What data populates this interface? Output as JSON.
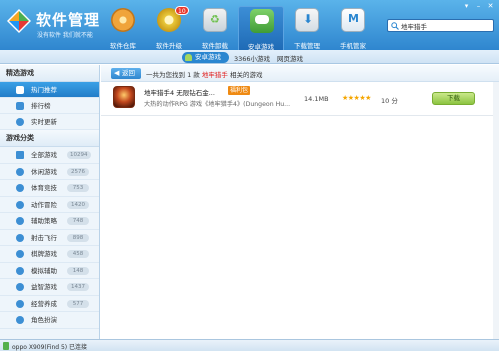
{
  "app": {
    "title": "软件管理",
    "slogan": "没有软件 我们就不能"
  },
  "nav": {
    "badge": "10",
    "items": [
      {
        "label": "软件仓库",
        "icon": "warehouse-disc-icon",
        "color": "#f0a43a"
      },
      {
        "label": "软件升级",
        "icon": "upgrade-arrow-icon",
        "color": "#e9c93b"
      },
      {
        "label": "软件卸载",
        "icon": "recycle-bin-icon",
        "color": "#6cc04a"
      },
      {
        "label": "安卓游戏",
        "icon": "android-gamepad-icon",
        "color": "#56b24f"
      },
      {
        "label": "下载管理",
        "icon": "download-folder-icon",
        "color": "#3d8fd4"
      },
      {
        "label": "手机管家",
        "icon": "phone-shield-icon",
        "color": "#2a86d0"
      }
    ]
  },
  "search": {
    "value": "地牢猎手"
  },
  "subtabs": {
    "active": "安卓游戏",
    "second": "3366小游戏",
    "third": "网页游戏"
  },
  "sidebar": {
    "featured_title": "精选游戏",
    "featured": [
      {
        "label": "热门推荐",
        "icon": "thumbs-up-icon"
      },
      {
        "label": "排行榜",
        "icon": "trophy-icon"
      },
      {
        "label": "实时更新",
        "icon": "clock-icon"
      }
    ],
    "category_title": "游戏分类",
    "categories": [
      {
        "label": "全部游戏",
        "count": "10294",
        "icon": "grid-icon"
      },
      {
        "label": "休闲游戏",
        "count": "2576",
        "icon": "cup-icon"
      },
      {
        "label": "体育竞技",
        "count": "753",
        "icon": "ball-icon"
      },
      {
        "label": "动作冒险",
        "count": "1420",
        "icon": "gear-icon"
      },
      {
        "label": "辅助策略",
        "count": "748",
        "icon": "pen-icon"
      },
      {
        "label": "射击飞行",
        "count": "898",
        "icon": "plane-icon"
      },
      {
        "label": "棋牌游戏",
        "count": "458",
        "icon": "chess-icon"
      },
      {
        "label": "模拟辅助",
        "count": "148",
        "icon": "wrench-icon"
      },
      {
        "label": "益智游戏",
        "count": "1437",
        "icon": "puzzle-icon"
      },
      {
        "label": "经营养成",
        "count": "577",
        "icon": "plant-icon"
      },
      {
        "label": "角色扮演",
        "count": "",
        "icon": "mask-icon"
      }
    ]
  },
  "results": {
    "back_label": "返回",
    "summary_prefix": "一共为您找到",
    "count": "1",
    "summary_mid": "款",
    "keyword": "地牢猎手",
    "summary_suffix": "相关的游戏"
  },
  "game": {
    "name": "地牢猎手4 无限钻石金...",
    "gift_label": "福利包",
    "desc": "大热的动作RPG 游戏《地牢猎手4》(Dungeon Hu...",
    "size": "14.1MB",
    "stars": "★★★★★",
    "score": "10 分",
    "download_label": "下载"
  },
  "status": {
    "device": "oppo X909(Find 5) 已连接"
  }
}
